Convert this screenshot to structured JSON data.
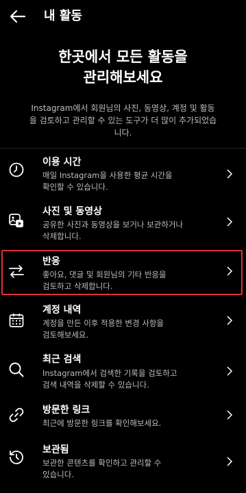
{
  "header": {
    "title": "내 활동"
  },
  "hero": {
    "title_line1": "한곳에서 모든 활동을",
    "title_line2": "관리해보세요",
    "description": "Instagram에서 회원님의 사진, 동영상, 계정 및 활동을 검토하고 관리할 수 있는 도구가 더 많이 추가되었습니다."
  },
  "items": [
    {
      "title": "이용 시간",
      "desc_line1": "매일 Instagram을 사용한 평균 시간을",
      "desc_line2": "확인할 수 있습니다.",
      "icon": "clock-icon"
    },
    {
      "title": "사진 및 동영상",
      "desc_line1": "공유한 사진과 동영상을 보거나 보관하거나",
      "desc_line2": "삭제합니다.",
      "icon": "photos-videos-icon"
    },
    {
      "title": "반응",
      "desc_line1": "좋아요, 댓글 및 회원님의 기타 반응을",
      "desc_line2": "검토하고 삭제합니다.",
      "icon": "swap-arrows-icon"
    },
    {
      "title": "계정 내역",
      "desc_line1": "계정을 만든 이후 적용한 변경 사항을",
      "desc_line2": "검토해보세요.",
      "icon": "calendar-icon"
    },
    {
      "title": "최근 검색",
      "desc_line1": "Instagram에서 검색한 기록을 검토하고",
      "desc_line2": "검색 내역을 삭제할 수 있습니다.",
      "icon": "search-icon"
    },
    {
      "title": "방문한 링크",
      "desc_line1": "최근에 방문한 링크를 확인해보세요.",
      "desc_line2": "",
      "icon": "link-icon"
    },
    {
      "title": "보관됨",
      "desc_line1": "보관한 콘텐츠를 확인하고 관리할 수",
      "desc_line2": "있습니다.",
      "icon": "archive-icon"
    }
  ],
  "colors": {
    "background": "#000000",
    "text": "#ffffff",
    "secondary_text": "#bdbdbd",
    "highlight_border": "#e0303a"
  }
}
